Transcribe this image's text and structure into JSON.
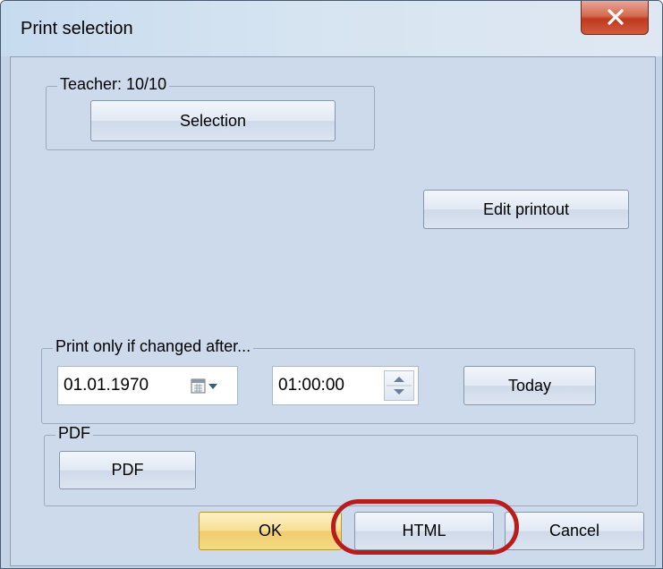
{
  "window": {
    "title": "Print selection"
  },
  "teacher_group": {
    "legend": "Teacher: 10/10",
    "selection_label": "Selection"
  },
  "edit_printout_label": "Edit printout",
  "changed_group": {
    "legend": "Print only if changed after...",
    "date_value": "01.01.1970",
    "time_value": "01:00:00",
    "today_label": "Today"
  },
  "pdf_group": {
    "legend": "PDF",
    "pdf_label": "PDF"
  },
  "footer": {
    "ok_label": "OK",
    "html_label": "HTML",
    "cancel_label": "Cancel"
  },
  "colors": {
    "highlight": "#b81c1c",
    "ok_button": "#f7df90",
    "close_button": "#c0391e"
  }
}
